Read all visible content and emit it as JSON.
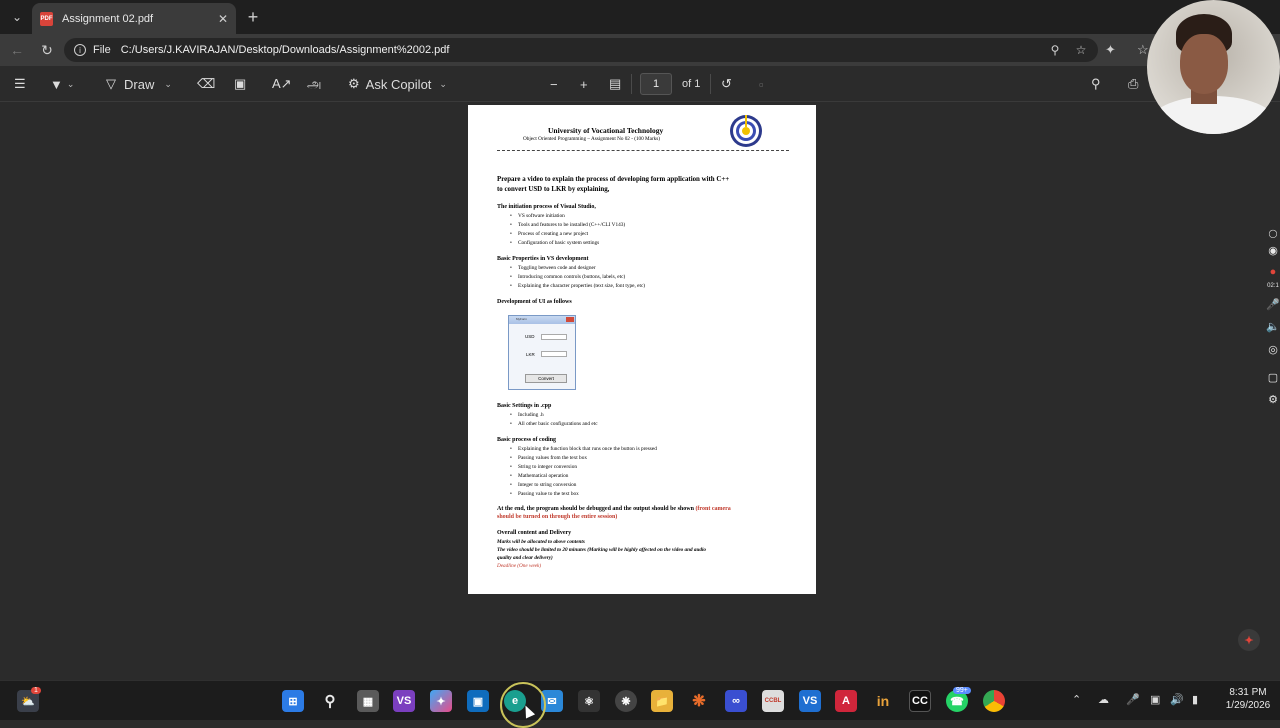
{
  "browser": {
    "tab_title": "Assignment 02.pdf",
    "tab_icon_label": "PDF",
    "address_scheme": "File",
    "address_url": "C:/Users/J.KAVIRAJAN/Desktop/Downloads/Assignment%2002.pdf"
  },
  "pdf_toolbar": {
    "draw_label": "Draw",
    "ask_copilot_label": "Ask Copilot",
    "page_number": "1",
    "page_total": "of 1"
  },
  "document": {
    "university": "University of Vocational Technology",
    "subtitle": "Object Oriented Programming – Assignment No 02 - (100 Marks)",
    "lead_line1": "Prepare a video to explain the process of developing form application with C++",
    "lead_line2": "to convert USD to LKR by explaining,",
    "s1_heading": "The initiation process of Visual Studio,",
    "s1_items": [
      "VS software initiation",
      "Tools and features to be installed (C++/CLI V143)",
      "Process of creating a new project",
      "Configuration of basic system settings"
    ],
    "s2_heading": "Basic Properties in VS development",
    "s2_items": [
      "Toggling between code and designer",
      "Introducing common controls (buttons, labels, etc)",
      "Explaining the character properties (text size, font type, etc)"
    ],
    "s3_heading": "Development of UI as follows",
    "form_preview": {
      "window_title": "MyForm",
      "usd_label": "USD",
      "lkr_label": "LKR",
      "convert_label": "Convert"
    },
    "s4_heading": "Basic Settings in .cpp",
    "s4_items": [
      "Including .h",
      "All other basic configurations and etc"
    ],
    "s5_heading": "Basic process of coding",
    "s5_items": [
      "Explaining the function block that runs once the button is pressed",
      "Passing values from the text box",
      "String to integer conversion",
      "Mathematical operation",
      "Integer to string conversion",
      "Passing value to the text box"
    ],
    "end_line1": "At the end, the program should be debugged and the output should be shown",
    "end_line1_red": "(front camera",
    "end_line2_red": "should be turned on through the entire session)",
    "s6_heading": "Overall content and Delivery",
    "s6_line1": "Marks will be allocated to above contents",
    "s6_line2": "The video should be limited to 20 minutes (Marking will be highly affected on the video and audio",
    "s6_line3": "quality and clear delivery)",
    "deadline": "Deadline (One week)"
  },
  "side_panel": {
    "timer": "02:1"
  },
  "taskbar": {
    "weather_badge": "1",
    "whatsapp_badge": "99+",
    "time": "8:31 PM",
    "date": "1/29/2026",
    "app_labels": {
      "vs": "VS",
      "vscode": "VS",
      "acrobat": "A",
      "invision": "in",
      "capcut": "CC",
      "ccbl": "CCBL"
    }
  },
  "colors": {
    "page_bg": "#2b2b2b",
    "chrome_bg": "#3b3b3b",
    "tabstrip_bg": "#1f1f1f",
    "accent_red": "#c0392b",
    "taskbar_bg": "#1c1c1c"
  }
}
